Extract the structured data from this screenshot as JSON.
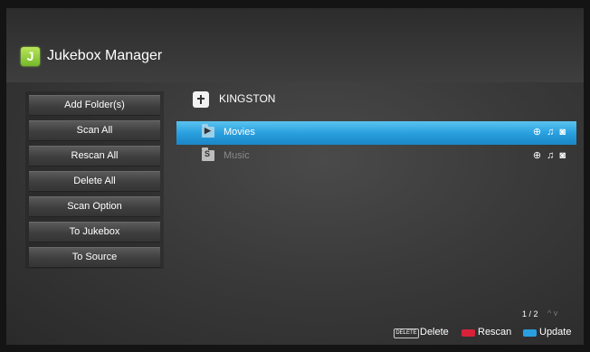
{
  "app": {
    "logo_letter": "J",
    "title": "Jukebox Manager"
  },
  "sidebar": {
    "items": [
      {
        "label": "Add Folder(s)"
      },
      {
        "label": "Scan All"
      },
      {
        "label": "Rescan All"
      },
      {
        "label": "Delete All"
      },
      {
        "label": "Scan Option"
      },
      {
        "label": "To Jukebox"
      },
      {
        "label": "To Source"
      }
    ]
  },
  "device": {
    "name": "KINGSTON"
  },
  "folders": [
    {
      "name": "Movies",
      "icon": "folder-icon",
      "selected": true,
      "media_icons": [
        "search-icon",
        "music-icon",
        "camera-icon"
      ]
    },
    {
      "name": "Music",
      "icon": "folder-icon",
      "selected": false,
      "media_icons": [
        "search-icon",
        "music-icon",
        "camera-icon"
      ]
    }
  ],
  "pagination": {
    "text": "1 / 2",
    "arrows": "^ v"
  },
  "footer": {
    "delete_key": "DELETE",
    "delete_label": "Delete",
    "rescan_label": "Rescan",
    "update_label": "Update",
    "rescan_color": "#d8223a",
    "update_color": "#2a9fe0"
  }
}
